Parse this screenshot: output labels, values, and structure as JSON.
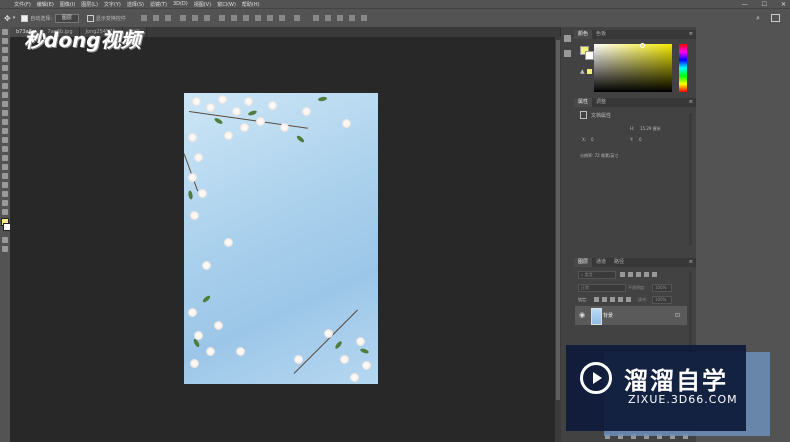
{
  "menubar": {
    "items": [
      "文件(F)",
      "编辑(E)",
      "图像(I)",
      "图层(L)",
      "文字(Y)",
      "选择(S)",
      "滤镜(T)",
      "3D(D)",
      "视图(V)",
      "窗口(W)",
      "帮助(H)"
    ],
    "window_controls": [
      "—",
      "☐",
      "✕"
    ]
  },
  "options": {
    "auto_select_label": "自动选择:",
    "auto_select_value": "图层",
    "show_transform_label": "显示变换控件"
  },
  "tabs": [
    {
      "label": "b73a8c",
      "active": true
    },
    {
      "label": "7ae6b.jpg",
      "active": false
    },
    {
      "label": "Jong254576",
      "active": false
    },
    {
      "label": "5fd9",
      "active": false
    }
  ],
  "logo": {
    "text": "秒dong视频"
  },
  "color_panel": {
    "tabs": [
      "颜色",
      "色板"
    ],
    "fg_color": "#f5f07a",
    "bg_color": "#ffffff"
  },
  "properties_panel": {
    "tabs": [
      "属性",
      "调整"
    ],
    "doc_props_label": "文档属性",
    "w_label": "W:",
    "w_value": "",
    "h_label": "H:",
    "h_value": "15.29 厘米",
    "x_label": "X:",
    "x_value": "0",
    "y_label": "Y:",
    "y_value": "0",
    "resolution_text": "分辨率: 72 像素/英寸"
  },
  "layers_panel": {
    "tabs": [
      "图层",
      "通道",
      "路径"
    ],
    "kind_label": "类型",
    "blend_mode": "正常",
    "opacity_label": "不透明度:",
    "opacity_value": "100%",
    "lock_label": "锁定:",
    "fill_label": "填充:",
    "fill_value": "100%",
    "layers": [
      {
        "name": "背景",
        "visible": true,
        "locked": true
      }
    ]
  },
  "watermark": {
    "title": "溜溜自学",
    "url": "ZIXUE.3D66.COM"
  }
}
